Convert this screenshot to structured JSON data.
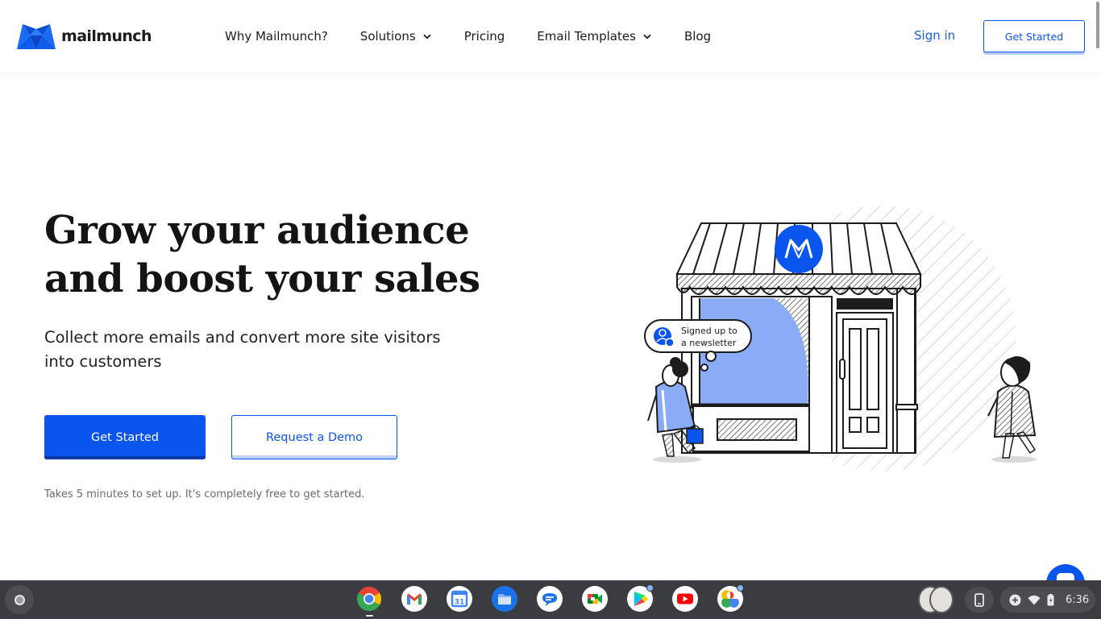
{
  "brand": {
    "name": "mailmunch",
    "primary_color": "#0a55ee",
    "text_color": "#141414"
  },
  "nav": {
    "items": [
      {
        "label": "Why Mailmunch?",
        "has_dropdown": false
      },
      {
        "label": "Solutions",
        "has_dropdown": true
      },
      {
        "label": "Pricing",
        "has_dropdown": false
      },
      {
        "label": "Email Templates",
        "has_dropdown": true
      },
      {
        "label": "Blog",
        "has_dropdown": false
      }
    ],
    "sign_in": "Sign in",
    "get_started": "Get Started"
  },
  "hero": {
    "title_line1": "Grow your audience",
    "title_line2": "and boost your sales",
    "subtitle": "Collect more emails and convert more site visitors into customers",
    "primary_cta": "Get Started",
    "secondary_cta": "Request a Demo",
    "fineprint": "Takes 5 minutes to set up. It's completely free to get started."
  },
  "illustration": {
    "bubble_line1": "Signed up to",
    "bubble_line2": "a newsletter",
    "shop_sign_icon": "mailmunch-logo-icon"
  },
  "chat_widget": {
    "icon": "chat-icon"
  },
  "shelf": {
    "apps": [
      {
        "name": "Chrome",
        "icon": "chrome-icon",
        "active": true,
        "badge": false
      },
      {
        "name": "Gmail",
        "icon": "gmail-icon",
        "active": false,
        "badge": false
      },
      {
        "name": "Google Calendar",
        "icon": "calendar-icon",
        "calendar_day": "31",
        "active": false,
        "badge": false
      },
      {
        "name": "Files",
        "icon": "files-icon",
        "active": false,
        "badge": false
      },
      {
        "name": "Messages",
        "icon": "messages-icon",
        "active": false,
        "badge": false
      },
      {
        "name": "Google Meet",
        "icon": "meet-icon",
        "active": false,
        "badge": false
      },
      {
        "name": "Play Store",
        "icon": "play-store-icon",
        "active": false,
        "badge": true
      },
      {
        "name": "YouTube",
        "icon": "youtube-icon",
        "active": false,
        "badge": false
      },
      {
        "name": "Google Photos",
        "icon": "photos-icon",
        "active": false,
        "badge": true
      }
    ],
    "time": "6:36",
    "status_icons": [
      "add-icon",
      "wifi-icon",
      "battery-icon"
    ]
  }
}
